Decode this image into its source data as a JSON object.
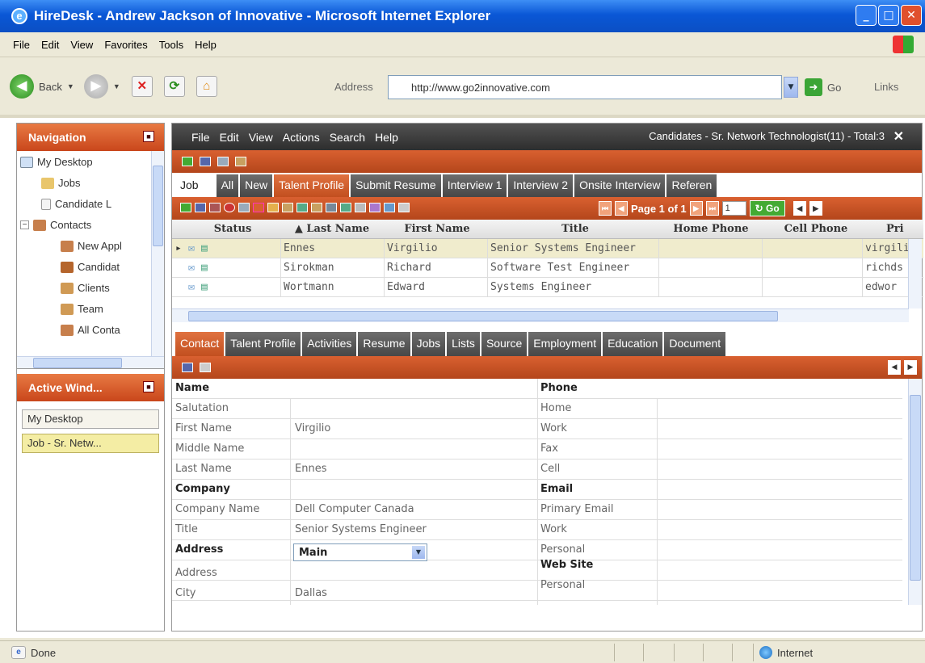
{
  "window": {
    "title": "HireDesk - Andrew Jackson of Innovative - Microsoft Internet Explorer"
  },
  "ie_menu": [
    "File",
    "Edit",
    "View",
    "Favorites",
    "Tools",
    "Help"
  ],
  "toolbar": {
    "back": "Back",
    "address_label": "Address",
    "url": "http://www.go2innovative.com",
    "go": "Go",
    "links": "Links"
  },
  "nav": {
    "title": "Navigation",
    "items": [
      {
        "label": "My Desktop",
        "icon": "desktop-icon"
      },
      {
        "label": "Jobs",
        "icon": "folder-icon"
      },
      {
        "label": "Candidate L",
        "icon": "document-icon"
      },
      {
        "label": "Contacts",
        "icon": "people-icon"
      },
      {
        "label": "New Appl",
        "icon": "people-icon"
      },
      {
        "label": "Candidat",
        "icon": "person-icon"
      },
      {
        "label": "Clients",
        "icon": "people-icon"
      },
      {
        "label": "Team",
        "icon": "people-icon"
      },
      {
        "label": "All Conta",
        "icon": "people-icon"
      }
    ]
  },
  "active": {
    "title": "Active Wind...",
    "items": [
      "My Desktop",
      "Job - Sr. Netw..."
    ]
  },
  "app_menu": {
    "items": [
      "File",
      "Edit",
      "View",
      "Actions",
      "Search",
      "Help"
    ],
    "context": "Candidates - Sr. Network Technologist(11) - Total:3",
    "close": "✕"
  },
  "tabs": [
    "Job",
    "All",
    "New",
    "Talent Profile",
    "Submit Resume",
    "Interview 1",
    "Interview 2",
    "Onsite Interview",
    "Referen"
  ],
  "pager": {
    "text": "Page 1 of 1",
    "input": "1",
    "go": "Go"
  },
  "grid": {
    "headers": [
      "Status",
      "▲ Last Name",
      "First Name",
      "Title",
      "Home Phone",
      "Cell Phone",
      "Pri"
    ],
    "rows": [
      {
        "last": "Ennes",
        "first": "Virgilio",
        "title": "Senior Systems Engineer",
        "email": "virgili"
      },
      {
        "last": "Sirokman",
        "first": "Richard",
        "title": "Software Test Engineer",
        "email": "richds"
      },
      {
        "last": "Wortmann",
        "first": "Edward",
        "title": "Systems Engineer",
        "email": "edwor"
      }
    ]
  },
  "btabs": [
    "Contact",
    "Talent Profile",
    "Activities",
    "Resume",
    "Jobs",
    "Lists",
    "Source",
    "Employment",
    "Education",
    "Document"
  ],
  "form": {
    "left": [
      {
        "label": "Name",
        "value": "",
        "section": true
      },
      {
        "label": "Salutation",
        "value": ""
      },
      {
        "label": "First Name",
        "value": "Virgilio"
      },
      {
        "label": "Middle Name",
        "value": ""
      },
      {
        "label": "Last Name",
        "value": "Ennes"
      },
      {
        "label": "Company",
        "value": "",
        "section": true
      },
      {
        "label": "Company Name",
        "value": "Dell Computer Canada"
      },
      {
        "label": "Title",
        "value": "Senior Systems Engineer"
      },
      {
        "label": "Address",
        "value": "Main",
        "section": true,
        "select": true
      },
      {
        "label": "Address",
        "value": ""
      },
      {
        "label": "City",
        "value": "Dallas"
      }
    ],
    "right": [
      {
        "label": "Phone",
        "section": true
      },
      {
        "label": "Home"
      },
      {
        "label": "Work"
      },
      {
        "label": "Fax"
      },
      {
        "label": "Cell"
      },
      {
        "label": "Email",
        "section": true
      },
      {
        "label": "Primary Email"
      },
      {
        "label": "Work"
      },
      {
        "label": "Personal"
      },
      {
        "label": "Web Site",
        "section": true
      },
      {
        "label": "Personal"
      }
    ]
  },
  "status": {
    "left": "Done",
    "zone": "Internet"
  },
  "colors": {
    "orange": "#c9461b",
    "dark": "#3d3d3d",
    "xp_blue": "#0a57d6"
  }
}
